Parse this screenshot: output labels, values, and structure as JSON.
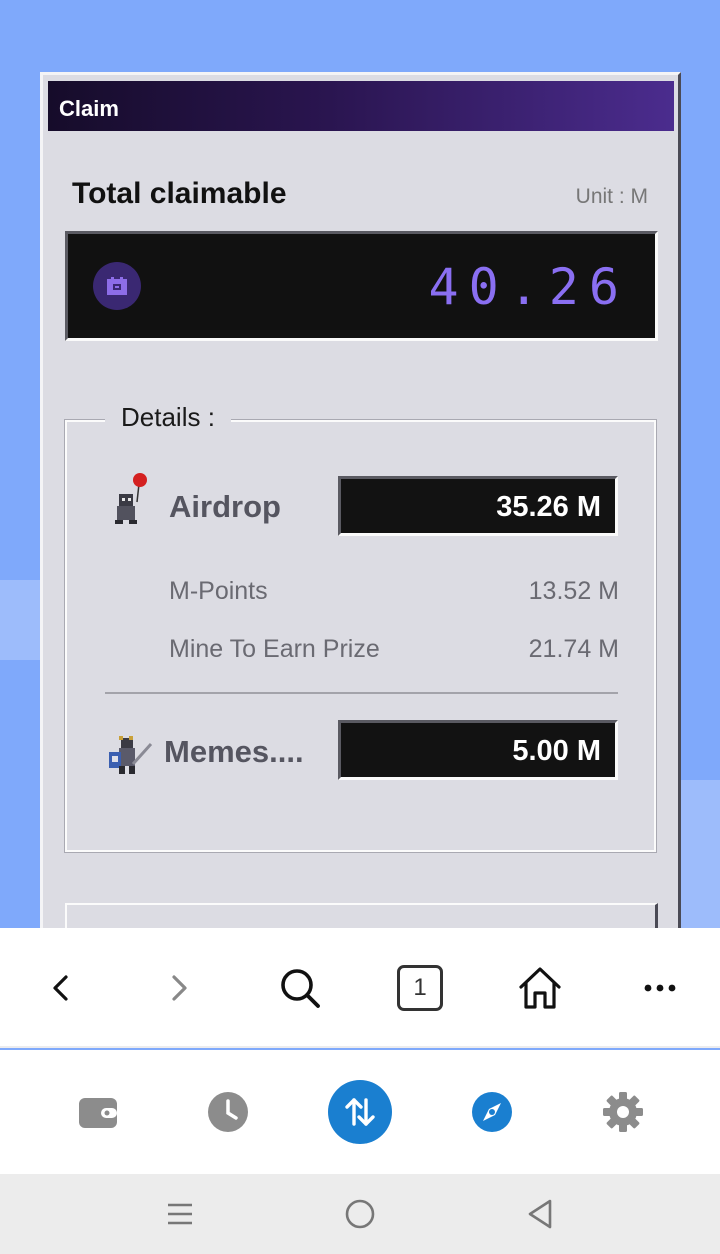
{
  "window": {
    "title": "Claim"
  },
  "claim": {
    "total_label": "Total claimable",
    "unit_label": "Unit : M",
    "total_value": "40.26"
  },
  "details": {
    "legend": "Details :",
    "airdrop": {
      "label": "Airdrop",
      "value": "35.26  M",
      "items": [
        {
          "label": "M-Points",
          "value": "13.52 M"
        },
        {
          "label": "Mine To Earn Prize",
          "value": "21.74 M"
        }
      ]
    },
    "memes": {
      "label": "Memes....",
      "value": "5.00  M"
    }
  },
  "browser_toolbar": {
    "tab_count": "1",
    "icons": [
      "back-icon",
      "forward-icon",
      "search-icon",
      "tabs-icon",
      "home-icon",
      "more-icon"
    ]
  },
  "app_nav": {
    "icons": [
      "wallet-icon",
      "history-icon",
      "swap-icon",
      "compass-icon",
      "settings-icon"
    ],
    "accent_color": "#1a7fd0"
  },
  "system_nav": {
    "icons": [
      "menu-icon",
      "home-circle-icon",
      "back-triangle-icon"
    ]
  }
}
